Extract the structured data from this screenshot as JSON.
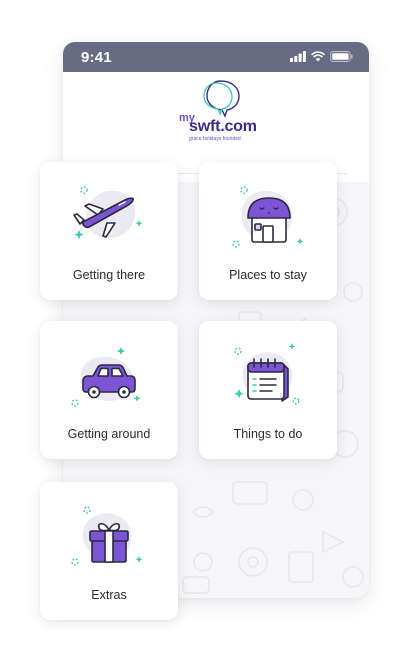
{
  "status_bar": {
    "time": "9:41"
  },
  "logo": {
    "prefix": "my",
    "name": "swft.com",
    "tagline": "grace holidays founded"
  },
  "colors": {
    "status_bar_bg": "#676c84",
    "icon_purple": "#7b55d6",
    "icon_accent": "#3ec8b0",
    "blob": "#ebe9f2"
  },
  "tiles": [
    {
      "label": "Getting there",
      "icon": "airplane-icon"
    },
    {
      "label": "Places to stay",
      "icon": "house-icon"
    },
    {
      "label": "Getting around",
      "icon": "car-icon"
    },
    {
      "label": "Things to do",
      "icon": "calendar-icon"
    },
    {
      "label": "Extras",
      "icon": "gift-icon"
    }
  ]
}
